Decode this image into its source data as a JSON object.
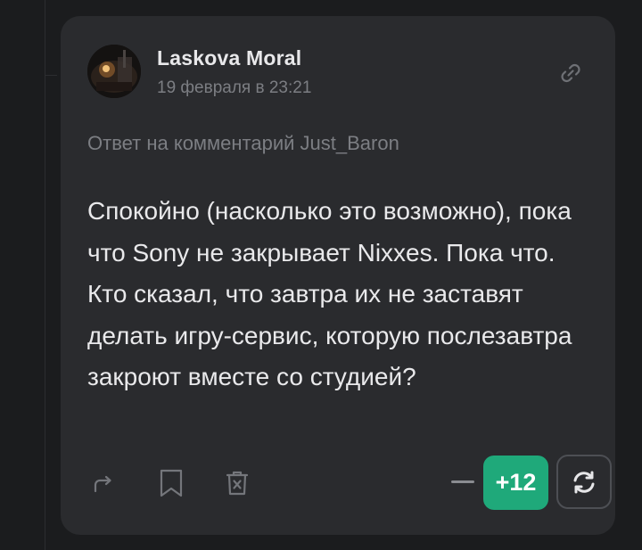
{
  "comment": {
    "author": "Laskova Moral",
    "date": "19 февраля в 23:21",
    "reply_to": "Ответ на комментарий Just_Baron",
    "text": "Спокойно (насколько это возможно), пока что Sony не закрывает Nixxes. Пока что. Кто сказал, что завтра их не заставят делать игру-сервис, которую послезавтра закроют вместе со студией?"
  },
  "actions": {
    "share_icon": "share-icon",
    "bookmark_icon": "bookmark-icon",
    "delete_icon": "trash-icon",
    "link_icon": "link-icon",
    "refresh_icon": "refresh-icon"
  },
  "rating": {
    "score": "+12"
  },
  "colors": {
    "background": "#1b1c1e",
    "card": "#2a2b2e",
    "accent_green": "#1fa97a",
    "muted_text": "#7c7e83",
    "text": "#e9e9eb"
  }
}
